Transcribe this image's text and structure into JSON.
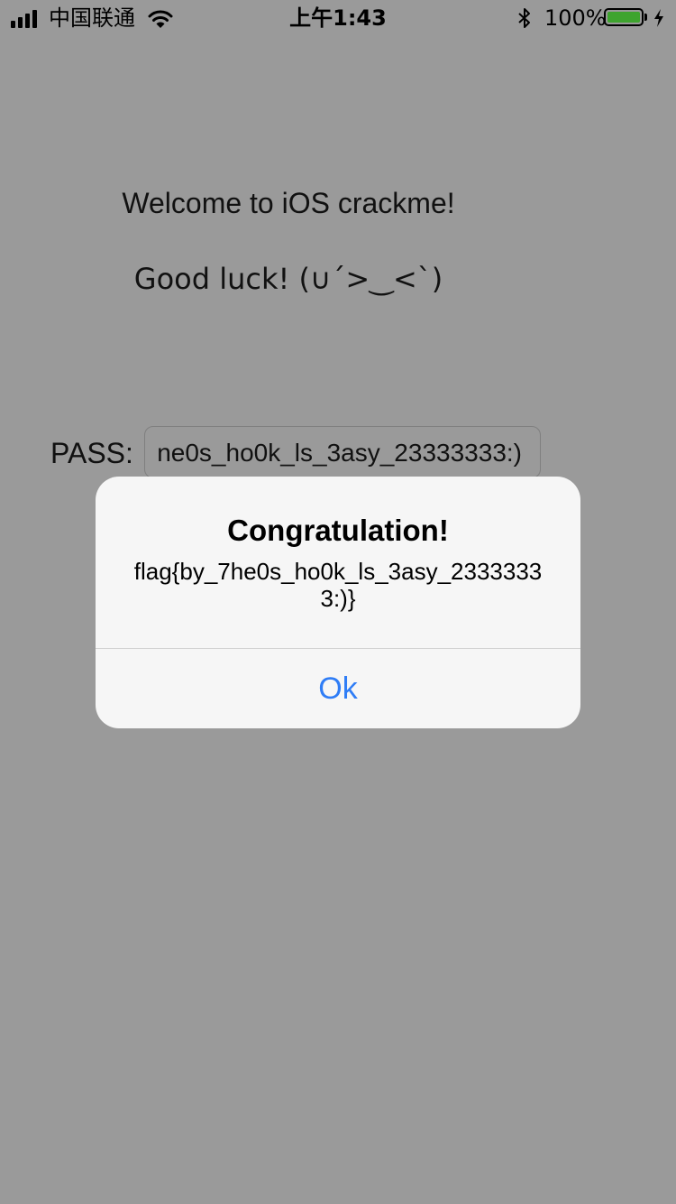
{
  "status_bar": {
    "carrier": "中国联通",
    "time": "上午1:43",
    "battery_percent": "100%",
    "battery_level": 1.0,
    "signal_bars": 4,
    "icons": [
      "signal-icon",
      "wifi-icon",
      "bluetooth-icon",
      "battery-icon",
      "charging-icon"
    ]
  },
  "main": {
    "welcome": "Welcome to iOS crackme!",
    "luck": "Good luck! (∪´>‿<`)",
    "pass_label": "PASS:",
    "pass_value": "ne0s_ho0k_ls_3asy_23333333:)"
  },
  "alert": {
    "title": "Congratulation!",
    "message": "flag{by_7he0s_ho0k_ls_3asy_23333333:)}",
    "button": "Ok"
  },
  "colors": {
    "background": "#9a9a9a",
    "alert_background": "#f6f6f6",
    "button_blue": "#2f7df6",
    "battery_green": "#3ea42e"
  }
}
